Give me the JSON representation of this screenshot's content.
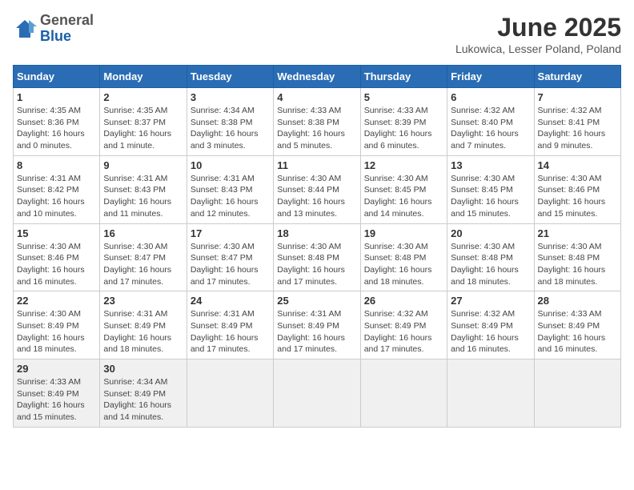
{
  "logo": {
    "general": "General",
    "blue": "Blue"
  },
  "header": {
    "title": "June 2025",
    "subtitle": "Lukowica, Lesser Poland, Poland"
  },
  "weekdays": [
    "Sunday",
    "Monday",
    "Tuesday",
    "Wednesday",
    "Thursday",
    "Friday",
    "Saturday"
  ],
  "weeks": [
    [
      {
        "day": "1",
        "info": "Sunrise: 4:35 AM\nSunset: 8:36 PM\nDaylight: 16 hours\nand 0 minutes."
      },
      {
        "day": "2",
        "info": "Sunrise: 4:35 AM\nSunset: 8:37 PM\nDaylight: 16 hours\nand 1 minute."
      },
      {
        "day": "3",
        "info": "Sunrise: 4:34 AM\nSunset: 8:38 PM\nDaylight: 16 hours\nand 3 minutes."
      },
      {
        "day": "4",
        "info": "Sunrise: 4:33 AM\nSunset: 8:38 PM\nDaylight: 16 hours\nand 5 minutes."
      },
      {
        "day": "5",
        "info": "Sunrise: 4:33 AM\nSunset: 8:39 PM\nDaylight: 16 hours\nand 6 minutes."
      },
      {
        "day": "6",
        "info": "Sunrise: 4:32 AM\nSunset: 8:40 PM\nDaylight: 16 hours\nand 7 minutes."
      },
      {
        "day": "7",
        "info": "Sunrise: 4:32 AM\nSunset: 8:41 PM\nDaylight: 16 hours\nand 9 minutes."
      }
    ],
    [
      {
        "day": "8",
        "info": "Sunrise: 4:31 AM\nSunset: 8:42 PM\nDaylight: 16 hours\nand 10 minutes."
      },
      {
        "day": "9",
        "info": "Sunrise: 4:31 AM\nSunset: 8:43 PM\nDaylight: 16 hours\nand 11 minutes."
      },
      {
        "day": "10",
        "info": "Sunrise: 4:31 AM\nSunset: 8:43 PM\nDaylight: 16 hours\nand 12 minutes."
      },
      {
        "day": "11",
        "info": "Sunrise: 4:30 AM\nSunset: 8:44 PM\nDaylight: 16 hours\nand 13 minutes."
      },
      {
        "day": "12",
        "info": "Sunrise: 4:30 AM\nSunset: 8:45 PM\nDaylight: 16 hours\nand 14 minutes."
      },
      {
        "day": "13",
        "info": "Sunrise: 4:30 AM\nSunset: 8:45 PM\nDaylight: 16 hours\nand 15 minutes."
      },
      {
        "day": "14",
        "info": "Sunrise: 4:30 AM\nSunset: 8:46 PM\nDaylight: 16 hours\nand 15 minutes."
      }
    ],
    [
      {
        "day": "15",
        "info": "Sunrise: 4:30 AM\nSunset: 8:46 PM\nDaylight: 16 hours\nand 16 minutes."
      },
      {
        "day": "16",
        "info": "Sunrise: 4:30 AM\nSunset: 8:47 PM\nDaylight: 16 hours\nand 17 minutes."
      },
      {
        "day": "17",
        "info": "Sunrise: 4:30 AM\nSunset: 8:47 PM\nDaylight: 16 hours\nand 17 minutes."
      },
      {
        "day": "18",
        "info": "Sunrise: 4:30 AM\nSunset: 8:48 PM\nDaylight: 16 hours\nand 17 minutes."
      },
      {
        "day": "19",
        "info": "Sunrise: 4:30 AM\nSunset: 8:48 PM\nDaylight: 16 hours\nand 18 minutes."
      },
      {
        "day": "20",
        "info": "Sunrise: 4:30 AM\nSunset: 8:48 PM\nDaylight: 16 hours\nand 18 minutes."
      },
      {
        "day": "21",
        "info": "Sunrise: 4:30 AM\nSunset: 8:48 PM\nDaylight: 16 hours\nand 18 minutes."
      }
    ],
    [
      {
        "day": "22",
        "info": "Sunrise: 4:30 AM\nSunset: 8:49 PM\nDaylight: 16 hours\nand 18 minutes."
      },
      {
        "day": "23",
        "info": "Sunrise: 4:31 AM\nSunset: 8:49 PM\nDaylight: 16 hours\nand 18 minutes."
      },
      {
        "day": "24",
        "info": "Sunrise: 4:31 AM\nSunset: 8:49 PM\nDaylight: 16 hours\nand 17 minutes."
      },
      {
        "day": "25",
        "info": "Sunrise: 4:31 AM\nSunset: 8:49 PM\nDaylight: 16 hours\nand 17 minutes."
      },
      {
        "day": "26",
        "info": "Sunrise: 4:32 AM\nSunset: 8:49 PM\nDaylight: 16 hours\nand 17 minutes."
      },
      {
        "day": "27",
        "info": "Sunrise: 4:32 AM\nSunset: 8:49 PM\nDaylight: 16 hours\nand 16 minutes."
      },
      {
        "day": "28",
        "info": "Sunrise: 4:33 AM\nSunset: 8:49 PM\nDaylight: 16 hours\nand 16 minutes."
      }
    ],
    [
      {
        "day": "29",
        "info": "Sunrise: 4:33 AM\nSunset: 8:49 PM\nDaylight: 16 hours\nand 15 minutes."
      },
      {
        "day": "30",
        "info": "Sunrise: 4:34 AM\nSunset: 8:49 PM\nDaylight: 16 hours\nand 14 minutes."
      },
      {
        "day": "",
        "info": ""
      },
      {
        "day": "",
        "info": ""
      },
      {
        "day": "",
        "info": ""
      },
      {
        "day": "",
        "info": ""
      },
      {
        "day": "",
        "info": ""
      }
    ]
  ]
}
